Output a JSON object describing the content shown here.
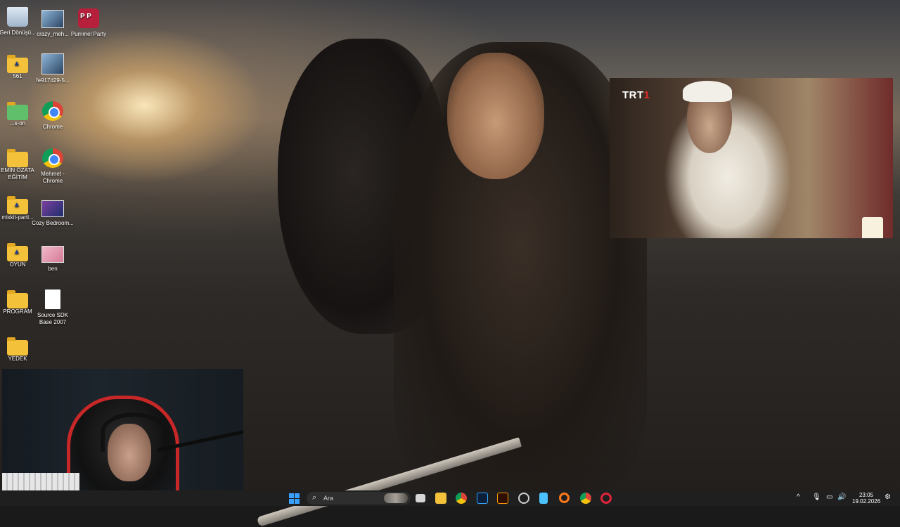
{
  "desktop": {
    "icons": [
      {
        "label": "Geri Dönüşü...",
        "icon": "recycle-bin-icon"
      },
      {
        "label": "crazy_meh...",
        "icon": "image-file-icon"
      },
      {
        "label": "Pummel Party",
        "icon": "pummel-party-icon"
      },
      {
        "label": "561",
        "icon": "folder-icon"
      },
      {
        "label": "fe917d29-5...",
        "icon": "image-file-icon"
      },
      {
        "label": "...s-on",
        "icon": "folder-icon"
      },
      {
        "label": "Chrome",
        "icon": "chrome-icon"
      },
      {
        "label": "EMİN ÖZATA EĞİTİM",
        "icon": "folder-icon"
      },
      {
        "label": "Mehmet - Chrome",
        "icon": "chrome-icon"
      },
      {
        "label": "mixkit-parti...",
        "icon": "folder-icon"
      },
      {
        "label": "Cozy Bedroom...",
        "icon": "image-file-icon"
      },
      {
        "label": "OYUN",
        "icon": "folder-icon"
      },
      {
        "label": "ben",
        "icon": "image-file-icon"
      },
      {
        "label": "PROGRAM",
        "icon": "folder-icon"
      },
      {
        "label": "Source SDK Base 2007",
        "icon": "document-icon"
      },
      {
        "label": "YEDEK",
        "icon": "folder-icon"
      }
    ]
  },
  "tv_overlay": {
    "logo_text": "TRT",
    "logo_number": "1"
  },
  "taskbar": {
    "search_placeholder": "Ara",
    "pinned": [
      {
        "name": "task-view",
        "color": "#cfcfcf"
      },
      {
        "name": "file-explorer",
        "color": "#f3c13a"
      },
      {
        "name": "chrome",
        "color": "#4285f4"
      },
      {
        "name": "photoshop",
        "color": "#31a8ff"
      },
      {
        "name": "illustrator",
        "color": "#ff9a00"
      },
      {
        "name": "settings-badge",
        "color": "#e23c3c"
      },
      {
        "name": "notepad",
        "color": "#4cc2ff"
      },
      {
        "name": "search-app",
        "color": "#ff7a1a"
      },
      {
        "name": "chrome-profile",
        "color": "#0f9d58"
      },
      {
        "name": "opera",
        "color": "#e0243a"
      }
    ],
    "clock_time": "23:05",
    "clock_date": "19.02.2026"
  },
  "colors": {
    "taskbar_bg": "#1f1f1f",
    "accent": "#3aa0ff",
    "trt_red": "#e12a2a"
  }
}
